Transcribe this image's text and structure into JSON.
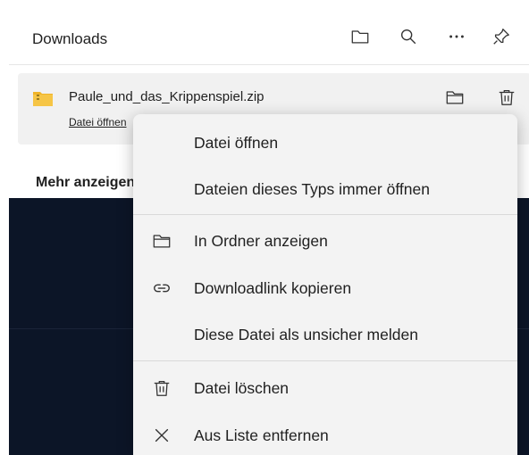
{
  "panel": {
    "title": "Downloads"
  },
  "item": {
    "filename": "Paule_und_das_Krippenspiel.zip",
    "open_link": "Datei öffnen"
  },
  "more_label": "Mehr anzeigen",
  "menu": {
    "open_file": "Datei öffnen",
    "always_open": "Dateien dieses Typs immer öffnen",
    "show_in_folder": "In Ordner anzeigen",
    "copy_link": "Downloadlink kopieren",
    "report_unsafe": "Diese Datei als unsicher melden",
    "delete_file": "Datei löschen",
    "remove_from_list": "Aus Liste entfernen"
  },
  "icons": {
    "header": [
      "folder-icon",
      "search-icon",
      "more-icon",
      "pin-icon"
    ],
    "item": [
      "zip-file-icon",
      "folder-icon",
      "trash-icon"
    ],
    "menu": [
      "folder-icon",
      "link-icon",
      "trash-icon",
      "close-icon"
    ]
  },
  "colors": {
    "menu_bg": "#f3f3f3",
    "item_bg": "#f1f1f1",
    "dark_bg": "#0c1527"
  }
}
